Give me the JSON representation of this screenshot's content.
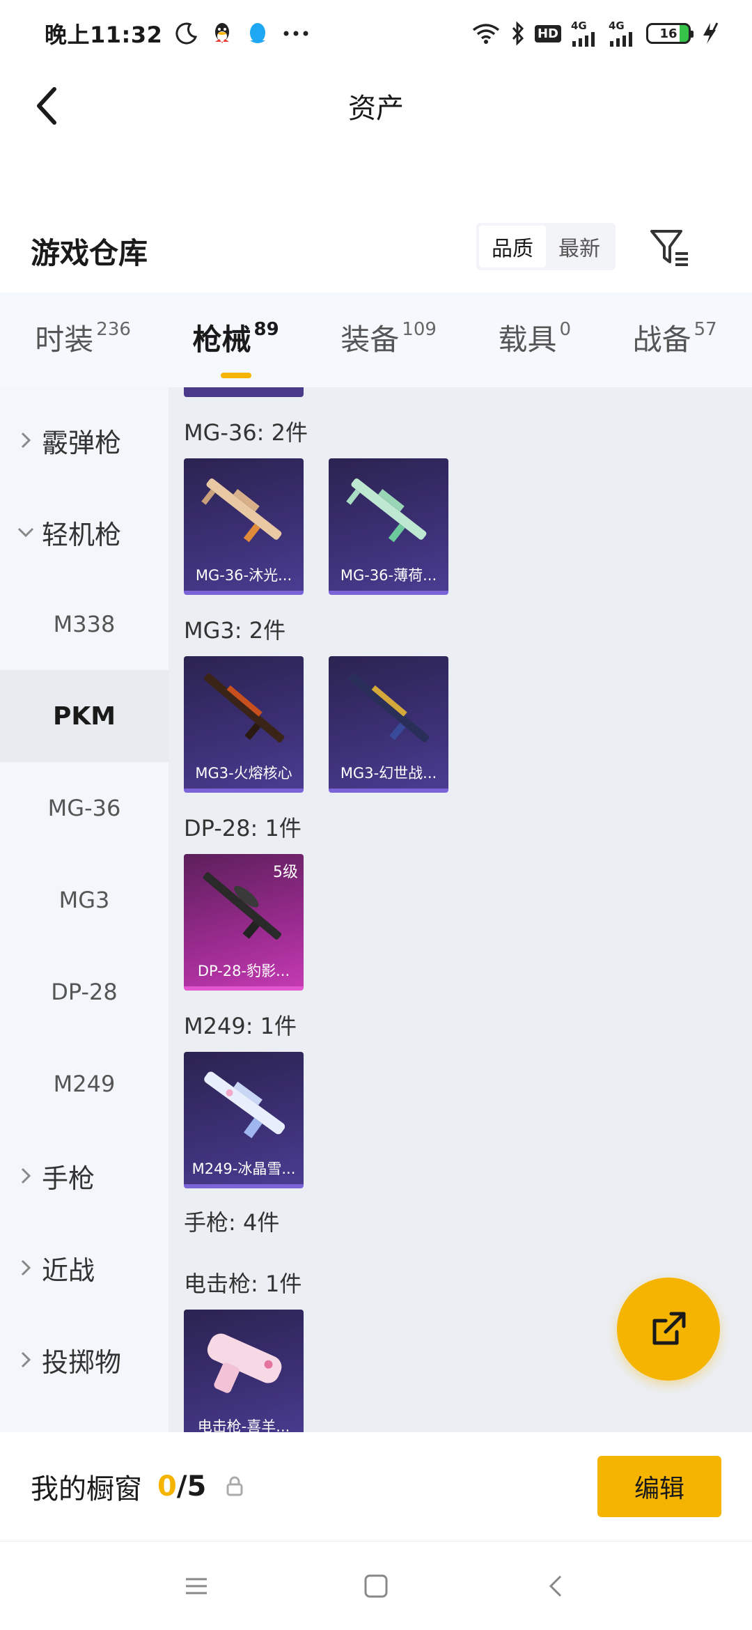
{
  "status_bar": {
    "time": "晚上11:32",
    "hd": "HD",
    "net1": "4G",
    "net2": "4G",
    "battery": "16",
    "icons": [
      "moon-icon",
      "qq-icon",
      "qq-chat-icon",
      "more-icon",
      "wifi-icon",
      "bluetooth-icon",
      "signal-icon",
      "charging-icon"
    ]
  },
  "header": {
    "title": "资产",
    "back_icon": "back-chevron-icon"
  },
  "section": {
    "title": "游戏仓库",
    "sort_options": [
      "品质",
      "最新"
    ],
    "active_sort": "品质",
    "filter_icon": "filter-icon"
  },
  "tabs": [
    {
      "label": "时装",
      "count": "236"
    },
    {
      "label": "枪械",
      "count": "89"
    },
    {
      "label": "装备",
      "count": "109"
    },
    {
      "label": "载具",
      "count": "0"
    },
    {
      "label": "战备",
      "count": "57"
    }
  ],
  "active_tab": "枪械",
  "sidebar": {
    "items": [
      {
        "label": "霰弹枪",
        "type": "category",
        "expanded": false
      },
      {
        "label": "轻机枪",
        "type": "category",
        "expanded": true
      },
      {
        "label": "M338",
        "type": "sub"
      },
      {
        "label": "PKM",
        "type": "sub",
        "active": true
      },
      {
        "label": "MG-36",
        "type": "sub"
      },
      {
        "label": "MG3",
        "type": "sub"
      },
      {
        "label": "DP-28",
        "type": "sub"
      },
      {
        "label": "M249",
        "type": "sub"
      },
      {
        "label": "手枪",
        "type": "category",
        "expanded": false
      },
      {
        "label": "近战",
        "type": "category",
        "expanded": false
      },
      {
        "label": "投掷物",
        "type": "category",
        "expanded": false
      }
    ]
  },
  "groups": [
    {
      "label": "MG-36: 2件",
      "items": [
        {
          "name": "MG-36-沐光..."
        },
        {
          "name": "MG-36-薄荷..."
        }
      ]
    },
    {
      "label": "MG3: 2件",
      "items": [
        {
          "name": "MG3-火熔核心"
        },
        {
          "name": "MG3-幻世战..."
        }
      ]
    },
    {
      "label": "DP-28: 1件",
      "items": [
        {
          "name": "DP-28-豹影...",
          "badge": "5级"
        }
      ]
    },
    {
      "label": "M249: 1件",
      "items": [
        {
          "name": "M249-冰晶雪..."
        }
      ]
    },
    {
      "label": "手枪: 4件",
      "items": []
    },
    {
      "label": "电击枪: 1件",
      "items": [
        {
          "name": "电击枪-喜羊..."
        }
      ]
    }
  ],
  "colors": {
    "accent": "#f5b400",
    "card_purple": "#3b2f73",
    "card_pink": "#9a2b8f",
    "sidebar_bg": "#f3f7fb",
    "content_bg": "#ebeef3"
  },
  "showcase": {
    "label": "我的橱窗",
    "current": "0",
    "separator": "/",
    "max": "5",
    "lock_icon": "lock-icon",
    "edit_label": "编辑"
  },
  "fab": {
    "icon": "share-export-icon"
  },
  "system_nav": {
    "icons": [
      "menu-icon",
      "home-icon",
      "back-icon"
    ]
  }
}
